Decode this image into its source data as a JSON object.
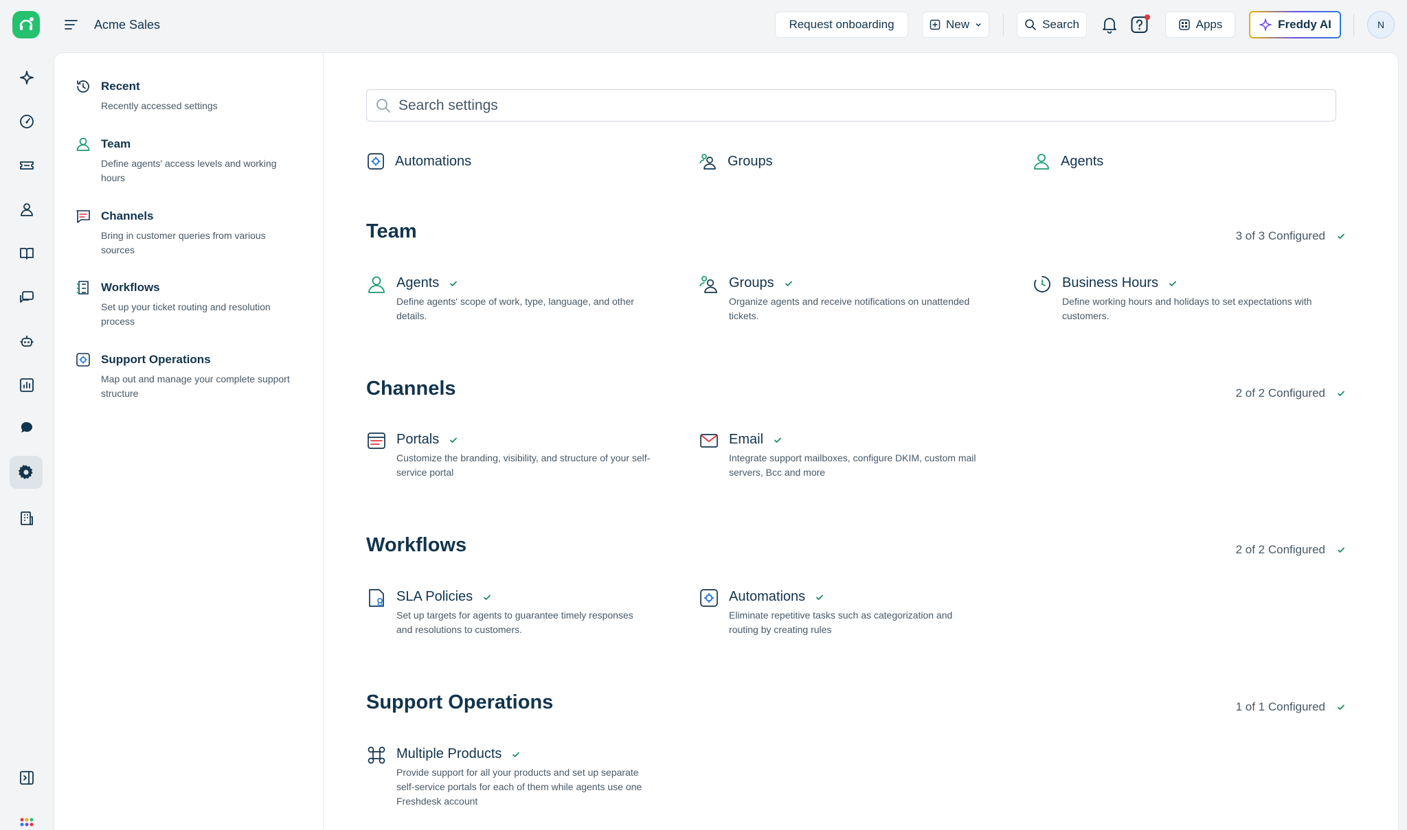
{
  "topbar": {
    "workspace_name": "Acme Sales",
    "request_onboarding": "Request onboarding",
    "new_label": "New",
    "search_label": "Search",
    "apps_label": "Apps",
    "freddy_label": "Freddy AI",
    "avatar_initial": "N"
  },
  "sidebar": {
    "items": [
      {
        "title": "Recent",
        "desc": "Recently accessed settings"
      },
      {
        "title": "Team",
        "desc": "Define agents' access levels and working hours"
      },
      {
        "title": "Channels",
        "desc": "Bring in customer queries from various sources"
      },
      {
        "title": "Workflows",
        "desc": "Set up your ticket routing and resolution process"
      },
      {
        "title": "Support Operations",
        "desc": "Map out and manage your complete support structure"
      }
    ]
  },
  "search": {
    "placeholder": "Search settings"
  },
  "quick_links": [
    "Automations",
    "Groups",
    "Agents"
  ],
  "sections": {
    "team": {
      "title": "Team",
      "count": "3 of 3 Configured",
      "cards": [
        {
          "title": "Agents",
          "desc": "Define agents' scope of work, type, language, and other details."
        },
        {
          "title": "Groups",
          "desc": "Organize agents and receive notifications on unattended tickets."
        },
        {
          "title": "Business Hours",
          "desc": "Define working hours and holidays to set expectations with customers."
        }
      ]
    },
    "channels": {
      "title": "Channels",
      "count": "2 of 2 Configured",
      "cards": [
        {
          "title": "Portals",
          "desc": "Customize the branding, visibility, and structure of your self-service portal"
        },
        {
          "title": "Email",
          "desc": "Integrate support mailboxes, configure DKIM, custom mail servers, Bcc and more"
        }
      ]
    },
    "workflows": {
      "title": "Workflows",
      "count": "2 of 2 Configured",
      "cards": [
        {
          "title": "SLA Policies",
          "desc": "Set up targets for agents to guarantee timely responses and resolutions to customers."
        },
        {
          "title": "Automations",
          "desc": "Eliminate repetitive tasks such as categorization and routing by creating rules"
        }
      ]
    },
    "support_ops": {
      "title": "Support Operations",
      "count": "1 of 1 Configured",
      "cards": [
        {
          "title": "Multiple Products",
          "desc": "Provide support for all your products and set up separate self-service portals for each of them while agents use one Freshdesk account"
        }
      ]
    }
  },
  "colors": {
    "brand": "#25c16f",
    "text": "#12344d",
    "muted": "#475867",
    "check": "#1a8c5a"
  }
}
